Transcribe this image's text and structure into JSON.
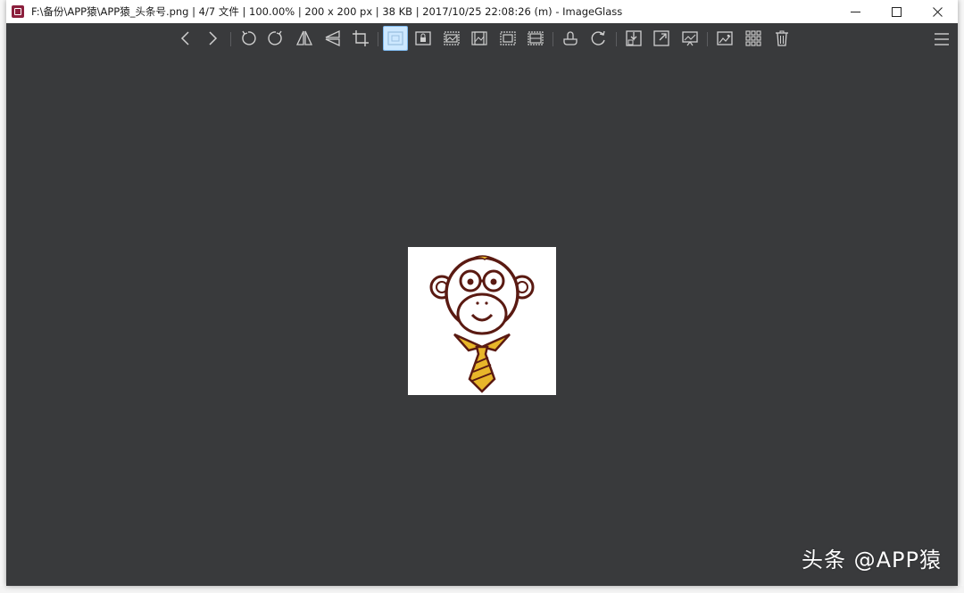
{
  "window": {
    "title": "F:\\备份\\APP猿\\APP猿_头条号.png  |  4/7 文件  |  100.00%  |  200 x 200 px  |  38 KB  |  2017/10/25 22:08:26 (m)  - ImageGlass",
    "accent_color": "#8b1f3c",
    "viewer_background": "#393a3c"
  },
  "toolbar": {
    "buttons": [
      {
        "name": "previous-image",
        "icon": "chevron-left-icon"
      },
      {
        "name": "next-image",
        "icon": "chevron-right-icon"
      },
      {
        "name": "rotate-left",
        "icon": "rotate-ccw-icon"
      },
      {
        "name": "rotate-right",
        "icon": "rotate-cw-icon"
      },
      {
        "name": "flip-horizontal",
        "icon": "flip-horizontal-icon"
      },
      {
        "name": "flip-vertical",
        "icon": "flip-vertical-icon"
      },
      {
        "name": "crop",
        "icon": "crop-icon"
      },
      {
        "name": "auto-zoom",
        "icon": "auto-zoom-icon",
        "active": true
      },
      {
        "name": "lock-zoom",
        "icon": "lock-zoom-icon"
      },
      {
        "name": "scale-to-width",
        "icon": "scale-width-icon"
      },
      {
        "name": "scale-to-height",
        "icon": "scale-height-icon"
      },
      {
        "name": "scale-to-fit",
        "icon": "scale-fit-icon"
      },
      {
        "name": "scale-to-fill",
        "icon": "scale-fill-icon"
      },
      {
        "name": "checkerboard",
        "icon": "checkerboard-icon"
      },
      {
        "name": "refresh",
        "icon": "refresh-icon"
      },
      {
        "name": "open-location",
        "icon": "open-location-icon"
      },
      {
        "name": "full-screen",
        "icon": "fullscreen-icon"
      },
      {
        "name": "slideshow",
        "icon": "slideshow-icon"
      },
      {
        "name": "set-wallpaper",
        "icon": "wallpaper-icon"
      },
      {
        "name": "thumbnail-bar",
        "icon": "thumbnail-grid-icon"
      },
      {
        "name": "delete",
        "icon": "trash-icon"
      }
    ],
    "menu_icon": "hamburger-menu-icon"
  },
  "watermark": "头条 @APP猿"
}
